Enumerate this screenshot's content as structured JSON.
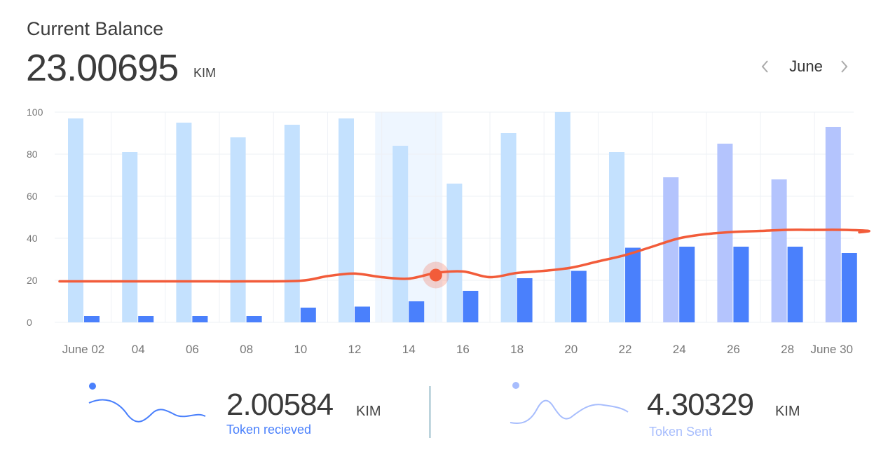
{
  "header": {
    "title": "Current Balance",
    "balance": "23.00695",
    "unit": "KIM"
  },
  "month_nav": {
    "prev_icon": "chevron-left-icon",
    "label": "June",
    "next_icon": "chevron-right-icon"
  },
  "chart_data": {
    "type": "bar",
    "title": "",
    "xlabel": "",
    "ylabel": "",
    "ylim": [
      0,
      100
    ],
    "yticks": [
      0,
      20,
      40,
      60,
      80,
      100
    ],
    "x_tick_labels": [
      "June 02",
      "04",
      "06",
      "08",
      "10",
      "12",
      "14",
      "16",
      "18",
      "20",
      "22",
      "24",
      "26",
      "28",
      "June 30"
    ],
    "categories": [
      "June 02",
      "04",
      "06",
      "08",
      "10",
      "12",
      "14",
      "16",
      "18",
      "20",
      "22",
      "24",
      "26",
      "28",
      "June 30"
    ],
    "grid": true,
    "legend": "none",
    "highlighted_category": "14",
    "series": [
      {
        "kind": "bar",
        "values": [
          97,
          81,
          95,
          88,
          94,
          97,
          84,
          66,
          90,
          100,
          81,
          69,
          85,
          68,
          93
        ],
        "colors": [
          "#c4e1fe",
          "#c4e1fe",
          "#c4e1fe",
          "#c4e1fe",
          "#c4e1fe",
          "#c4e1fe",
          "#c4e1fe",
          "#c4e1fe",
          "#c4e1fe",
          "#c4e1fe",
          "#c4e1fe",
          "#b4c4fd",
          "#b4c4fd",
          "#b4c4fd",
          "#b4c4fd"
        ]
      },
      {
        "kind": "bar",
        "values": [
          3,
          3,
          3,
          3,
          7,
          7.5,
          10,
          15,
          21,
          24.5,
          35.5,
          36,
          36,
          36,
          33
        ],
        "color": "#4a80fc"
      },
      {
        "kind": "line",
        "x": [
          0,
          1,
          2,
          3,
          4,
          4.5,
          5,
          5.5,
          6,
          6.5,
          7,
          7.5,
          8,
          8.5,
          9,
          9.5,
          10,
          10.5,
          11,
          11.5,
          12,
          12.5,
          13,
          13.5,
          14,
          14.5
        ],
        "values": [
          19.5,
          19.5,
          19.5,
          19.5,
          19.8,
          22,
          23.2,
          21.5,
          20.8,
          23.5,
          24.2,
          21.5,
          23.5,
          24.5,
          26,
          29,
          32,
          36,
          40,
          42,
          43,
          43.5,
          44,
          44,
          44,
          43.5
        ],
        "color": "#f25c3a",
        "marker": {
          "x": 6.5,
          "value": 22.5
        }
      }
    ]
  },
  "stats": {
    "received": {
      "value": "2.00584",
      "unit": "KIM",
      "label": "Token recieved",
      "color": "#4a80fc"
    },
    "sent": {
      "value": "4.30329",
      "unit": "KIM",
      "label": "Token Sent",
      "color": "#a7bdfd"
    }
  }
}
